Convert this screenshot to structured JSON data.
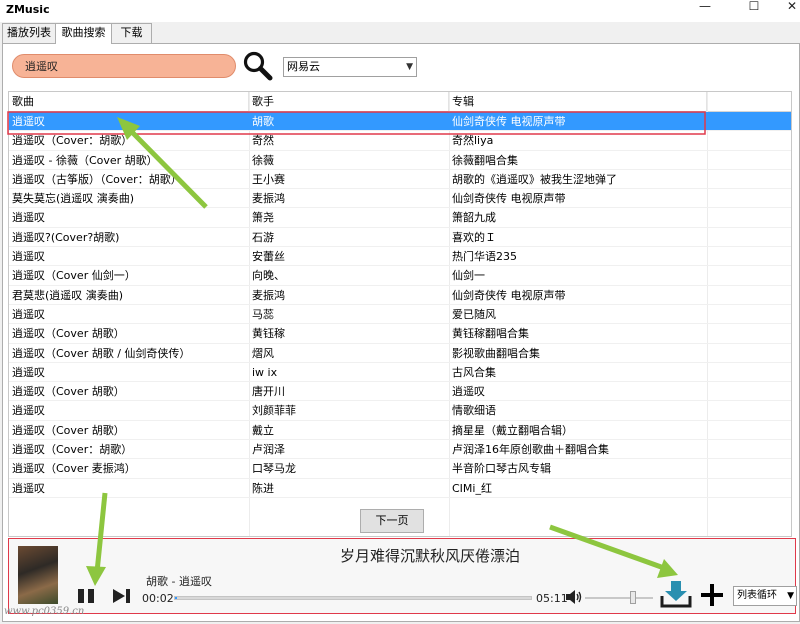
{
  "window": {
    "title": "ZMusic",
    "minimize": "—",
    "maximize": "☐",
    "close": "✕"
  },
  "tabs": [
    {
      "label": "播放列表"
    },
    {
      "label": "歌曲搜索"
    },
    {
      "label": "下载"
    }
  ],
  "search": {
    "value": "逍遥叹",
    "icon": "search-icon",
    "source": "网易云"
  },
  "table": {
    "columns": [
      "歌曲",
      "歌手",
      "专辑"
    ],
    "rows": [
      [
        "逍遥叹",
        "胡歌",
        "仙剑奇侠传 电视原声带"
      ],
      [
        "逍遥叹（Cover：胡歌）",
        "奇然",
        "奇然liya"
      ],
      [
        "逍遥叹 - 徐薇（Cover 胡歌）",
        "徐薇",
        "徐薇翻唱合集"
      ],
      [
        "逍遥叹（古筝版）（Cover：胡歌）",
        "王小赛",
        "胡歌的《逍遥叹》被我生涩地弹了"
      ],
      [
        "莫失莫忘(逍遥叹 演奏曲)",
        "麦振鸿",
        "仙剑奇侠传 电视原声带"
      ],
      [
        "逍遥叹",
        "箫尧",
        "箫韶九成"
      ],
      [
        "逍遥叹?(Cover?胡歌)",
        "石游",
        "喜欢的Ｉ"
      ],
      [
        "逍遥叹",
        "安蕾丝",
        "热门华语235"
      ],
      [
        "逍遥叹（Cover 仙剑一）",
        "向晚、",
        "仙剑一"
      ],
      [
        "君莫悲(逍遥叹 演奏曲)",
        "麦振鸿",
        "仙剑奇侠传 电视原声带"
      ],
      [
        "逍遥叹",
        "马蕊",
        "爱已随风"
      ],
      [
        "逍遥叹（Cover 胡歌）",
        "黄钰稼",
        "黄钰稼翻唱合集"
      ],
      [
        "逍遥叹（Cover 胡歌 / 仙剑奇侠传）",
        "熠风",
        "影视歌曲翻唱合集"
      ],
      [
        "逍遥叹",
        "iw ix",
        "古风合集"
      ],
      [
        "逍遥叹（Cover 胡歌）",
        "唐开川",
        "逍遥叹"
      ],
      [
        "逍遥叹",
        "刘颜菲菲",
        "情歌细语"
      ],
      [
        "逍遥叹（Cover 胡歌）",
        "戴立",
        "摘星星（戴立翻唱合辑）"
      ],
      [
        "逍遥叹（Cover：胡歌）",
        "卢润泽",
        "卢润泽16年原创歌曲＋翻唱合集"
      ],
      [
        "逍遥叹（Cover 麦振鸿）",
        "口琴马龙",
        "半音阶口琴古风专辑"
      ],
      [
        "逍遥叹",
        "陈进",
        "CIMi_红"
      ]
    ],
    "selected_index": 0,
    "next_page": "下一页"
  },
  "player": {
    "lyric": "岁月难得沉默秋风厌倦漂泊",
    "now_playing": "胡歌 - 逍遥叹",
    "elapsed": "00:02",
    "duration": "05:11",
    "progress": 0.006,
    "volume": 0.7,
    "mode": "列表循环",
    "icons": [
      "album-cover",
      "pause-icon",
      "next-icon",
      "volume-icon",
      "download-icon",
      "add-icon"
    ]
  },
  "colors": {
    "selection": "#3399ff",
    "search_fill": "#f7b396",
    "highlight_border": "#e0394a",
    "annotation_arrow": "#8dc63f",
    "download_icon": "#2a8fb0"
  },
  "watermark": "www.pc0359.cn"
}
